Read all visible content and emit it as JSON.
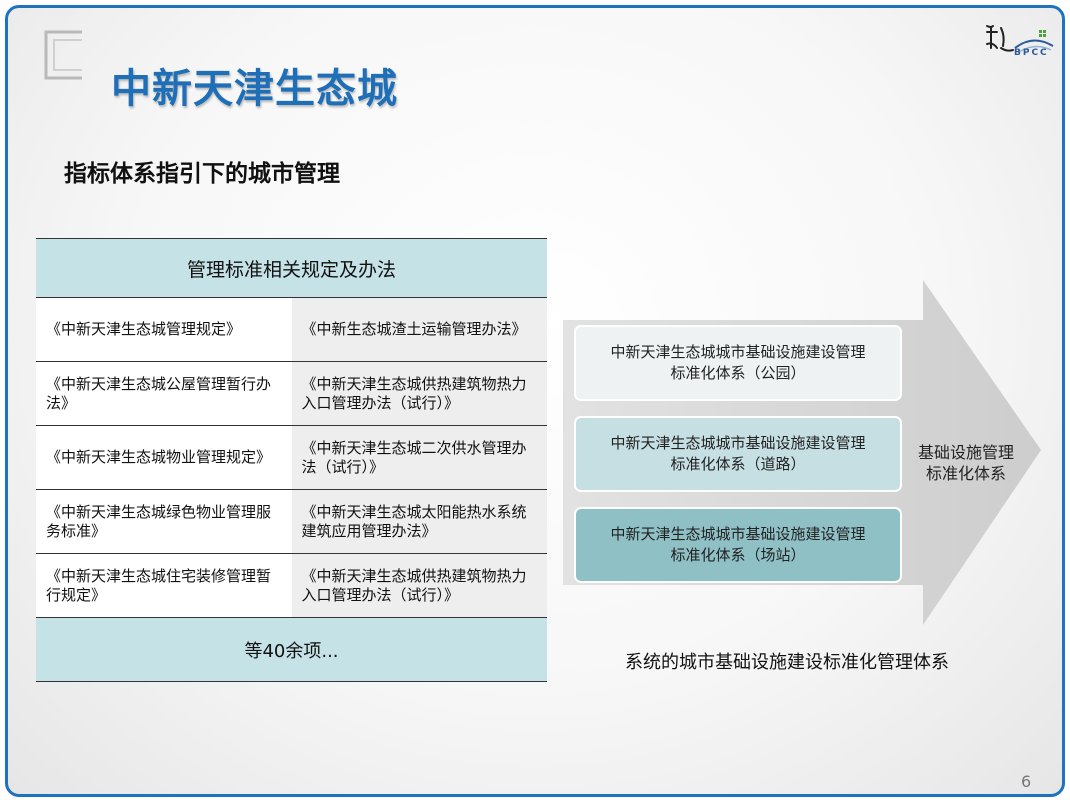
{
  "slide_title": "中新天津生态城",
  "subtitle": "指标体系指引下的城市管理",
  "logo": {
    "brand": "BPCC"
  },
  "table": {
    "header": "管理标准相关规定及办法",
    "rows": [
      {
        "left": "《中新天津生态城管理规定》",
        "right": "《中新生态城渣土运输管理办法》"
      },
      {
        "left": "《中新天津生态城公屋管理暂行办法》",
        "right": "《中新天津生态城供热建筑物热力入口管理办法（试行）》"
      },
      {
        "left": "《中新天津生态城物业管理规定》",
        "right": "《中新天津生态城二次供水管理办法（试行）》"
      },
      {
        "left": "《中新天津生态城绿色物业管理服务标准》",
        "right": "《中新天津生态城太阳能热水系统建筑应用管理办法》"
      },
      {
        "left": "《中新天津生态城住宅装修管理暂行规定》",
        "right": "《中新天津生态城供热建筑物热力入口管理办法（试行）》"
      }
    ],
    "footer": "等40余项..."
  },
  "system": {
    "boxes": [
      {
        "line1": "中新天津生态城城市基础设施建设管理",
        "line2": "标准化体系（公园）"
      },
      {
        "line1": "中新天津生态城城市基础设施建设管理",
        "line2": "标准化体系（道路）"
      },
      {
        "line1": "中新天津生态城城市基础设施建设管理",
        "line2": "标准化体系（场站）"
      }
    ],
    "arrow_label": {
      "line1": "基础设施管理",
      "line2": "标准化体系"
    },
    "caption": "系统的城市基础设施建设标准化管理体系"
  },
  "page_number": "6",
  "colors": {
    "title": "#1f6fb8",
    "frame": "#1e73be",
    "table_head": "#c5e2e6",
    "box_light": "#eef2f2",
    "box_mid": "#c6dfe2",
    "box_dark": "#8fc0c6",
    "arrow": "#d3d3d3"
  }
}
